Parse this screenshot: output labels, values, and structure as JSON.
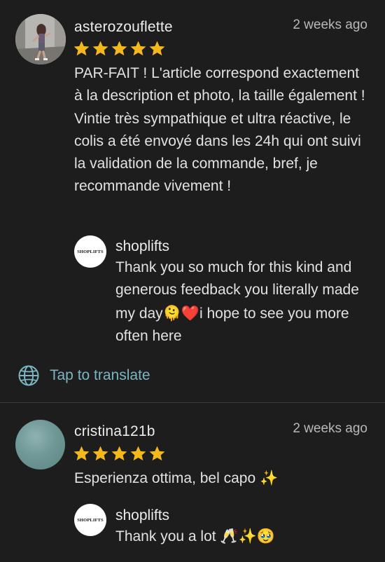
{
  "reviews": [
    {
      "username": "asterozouflette",
      "time": "2 weeks ago",
      "rating": 5,
      "text": "PAR-FAIT ! L'article correspond exactement à la description et photo, la taille également !  Vintie très sympathique et ultra réactive, le colis a été envoyé dans les 24h qui ont suivi la validation de la commande, bref, je recommande vivement !",
      "reply": {
        "seller": "shoplifts",
        "logo_text": "SHOPLIFTS",
        "text_before": "Thank you so much for this kind and generous feedback you literally made my day",
        "emojis": "🫠❤️",
        "text_after": "i hope to see you more often here"
      },
      "translate_label": "Tap to translate"
    },
    {
      "username": "cristina121b",
      "time": "2 weeks ago",
      "rating": 5,
      "text": "Esperienza ottima, bel capo ✨",
      "reply": {
        "seller": "shoplifts",
        "logo_text": "SHOPLIFTS",
        "text": "Thank you a lot 🥂✨🥹"
      }
    }
  ],
  "colors": {
    "background": "#1d1d1d",
    "star": "#f5b81c",
    "link": "#7bb5c3"
  },
  "icons": {
    "translate": "globe-icon",
    "rating": "star-icon"
  }
}
